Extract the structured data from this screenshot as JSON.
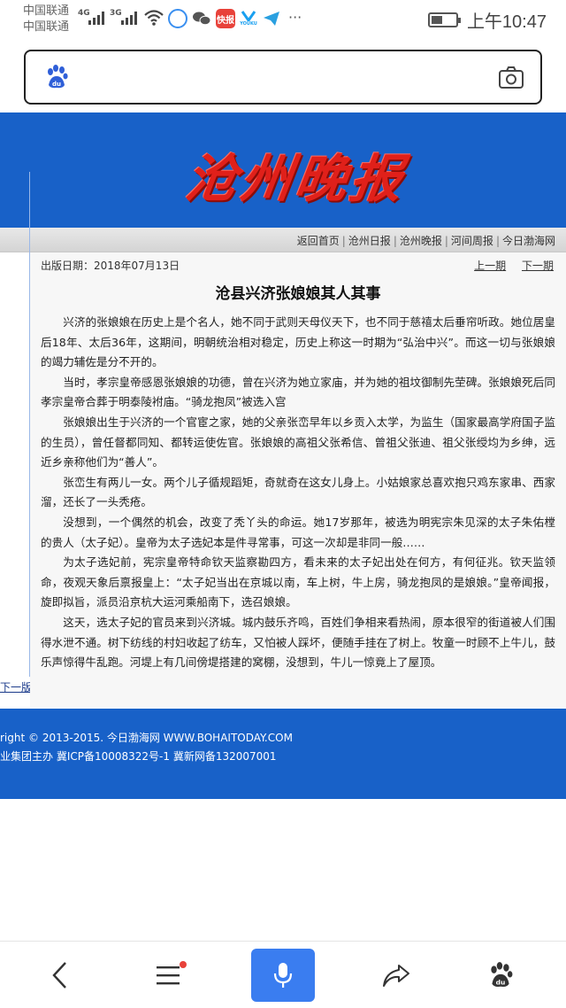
{
  "status_bar": {
    "carrier1": "中国联通",
    "carrier2": "中国联通",
    "net1": "4G",
    "net2": "3G",
    "app_icons": [
      {
        "name": "qq-browser-icon",
        "label": "",
        "color": "#3a8ff0"
      },
      {
        "name": "wechat-icon",
        "label": "",
        "color": "#555555"
      },
      {
        "name": "kuaibao-icon",
        "label": "快报",
        "color": "#e8423a"
      },
      {
        "name": "youku-icon",
        "label": "YOUKU",
        "color": "#1aa0f0"
      },
      {
        "name": "telegram-icon",
        "label": "",
        "color": "#2aa0e0"
      }
    ],
    "more": "···",
    "battery_level": 0.45,
    "time": "上午10:47"
  },
  "search": {
    "placeholder": "",
    "value": ""
  },
  "masthead": {
    "logo_text": "沧州晚报"
  },
  "nav": {
    "links": [
      "返回首页",
      "沧州日报",
      "沧州晚报",
      "河间周报",
      "今日渤海网"
    ]
  },
  "article": {
    "pub_date": "出版日期：2018年07月13日",
    "prev": "上一期",
    "next": "下一期",
    "title": "沧县兴济张娘娘其人其事",
    "paragraphs": [
      "兴济的张娘娘在历史上是个名人，她不同于武则天母仪天下，也不同于慈禧太后垂帘听政。她位居皇后18年、太后36年，这期间，明朝统治相对稳定，历史上称这一时期为“弘治中兴”。而这一切与张娘娘的竭力辅佐是分不开的。",
      "当时，孝宗皇帝感恩张娘娘的功德，曾在兴济为她立家庙，并为她的祖坟御制先茔碑。张娘娘死后同孝宗皇帝合葬于明泰陵袝庙。“骑龙抱凤”被选入宫",
      "张娘娘出生于兴济的一个官宦之家，她的父亲张峦早年以乡贡入太学，为监生（国家最高学府国子监的生员），曾任督都同知、都转运使佐官。张娘娘的高祖父张希信、曾祖父张迪、祖父张绶均为乡绅，远近乡亲称他们为“善人”。",
      "张峦生有两儿一女。两个儿子循规蹈矩，奇就奇在这女儿身上。小姑娘家总喜欢抱只鸡东家串、西家溜，还长了一头秃疮。",
      "没想到，一个偶然的机会，改变了秃丫头的命运。她17岁那年，被选为明宪宗朱见深的太子朱佑樘的贵人（太子妃）。皇帝为太子选妃本是件寻常事，可这一次却是非同一般……",
      "为太子选妃前，宪宗皇帝特命钦天监察勘四方，看未来的太子妃出处在何方，有何征兆。钦天监领命，夜观天象后禀报皇上：“太子妃当出在京城以南，车上树，牛上房，骑龙抱凤的是娘娘。”皇帝闻报，旋即拟旨，派员沿京杭大运河乘船南下，选召娘娘。",
      "这天，选太子妃的官员来到兴济城。城内鼓乐齐鸣，百姓们争相来看热闹，原本很窄的街道被人们围得水泄不通。树下纺线的村妇收起了纺车，又怕被人踩坏，便随手挂在了树上。牧童一时顾不上牛儿，鼓乐声惊得牛乱跑。河堤上有几间傍堤搭建的窝棚，没想到，牛儿一惊竟上了屋顶。"
    ]
  },
  "left_panel": {
    "next_issue_link": "下一版"
  },
  "footer": {
    "line1": "right © 2013-2015. 今日渤海网 WWW.BOHAITODAY.COM",
    "line2": "业集团主办    冀ICP备10008322号-1    冀新网备132007001"
  },
  "toolbar": {
    "buttons": [
      "back",
      "menu",
      "voice",
      "share",
      "baidu"
    ]
  }
}
